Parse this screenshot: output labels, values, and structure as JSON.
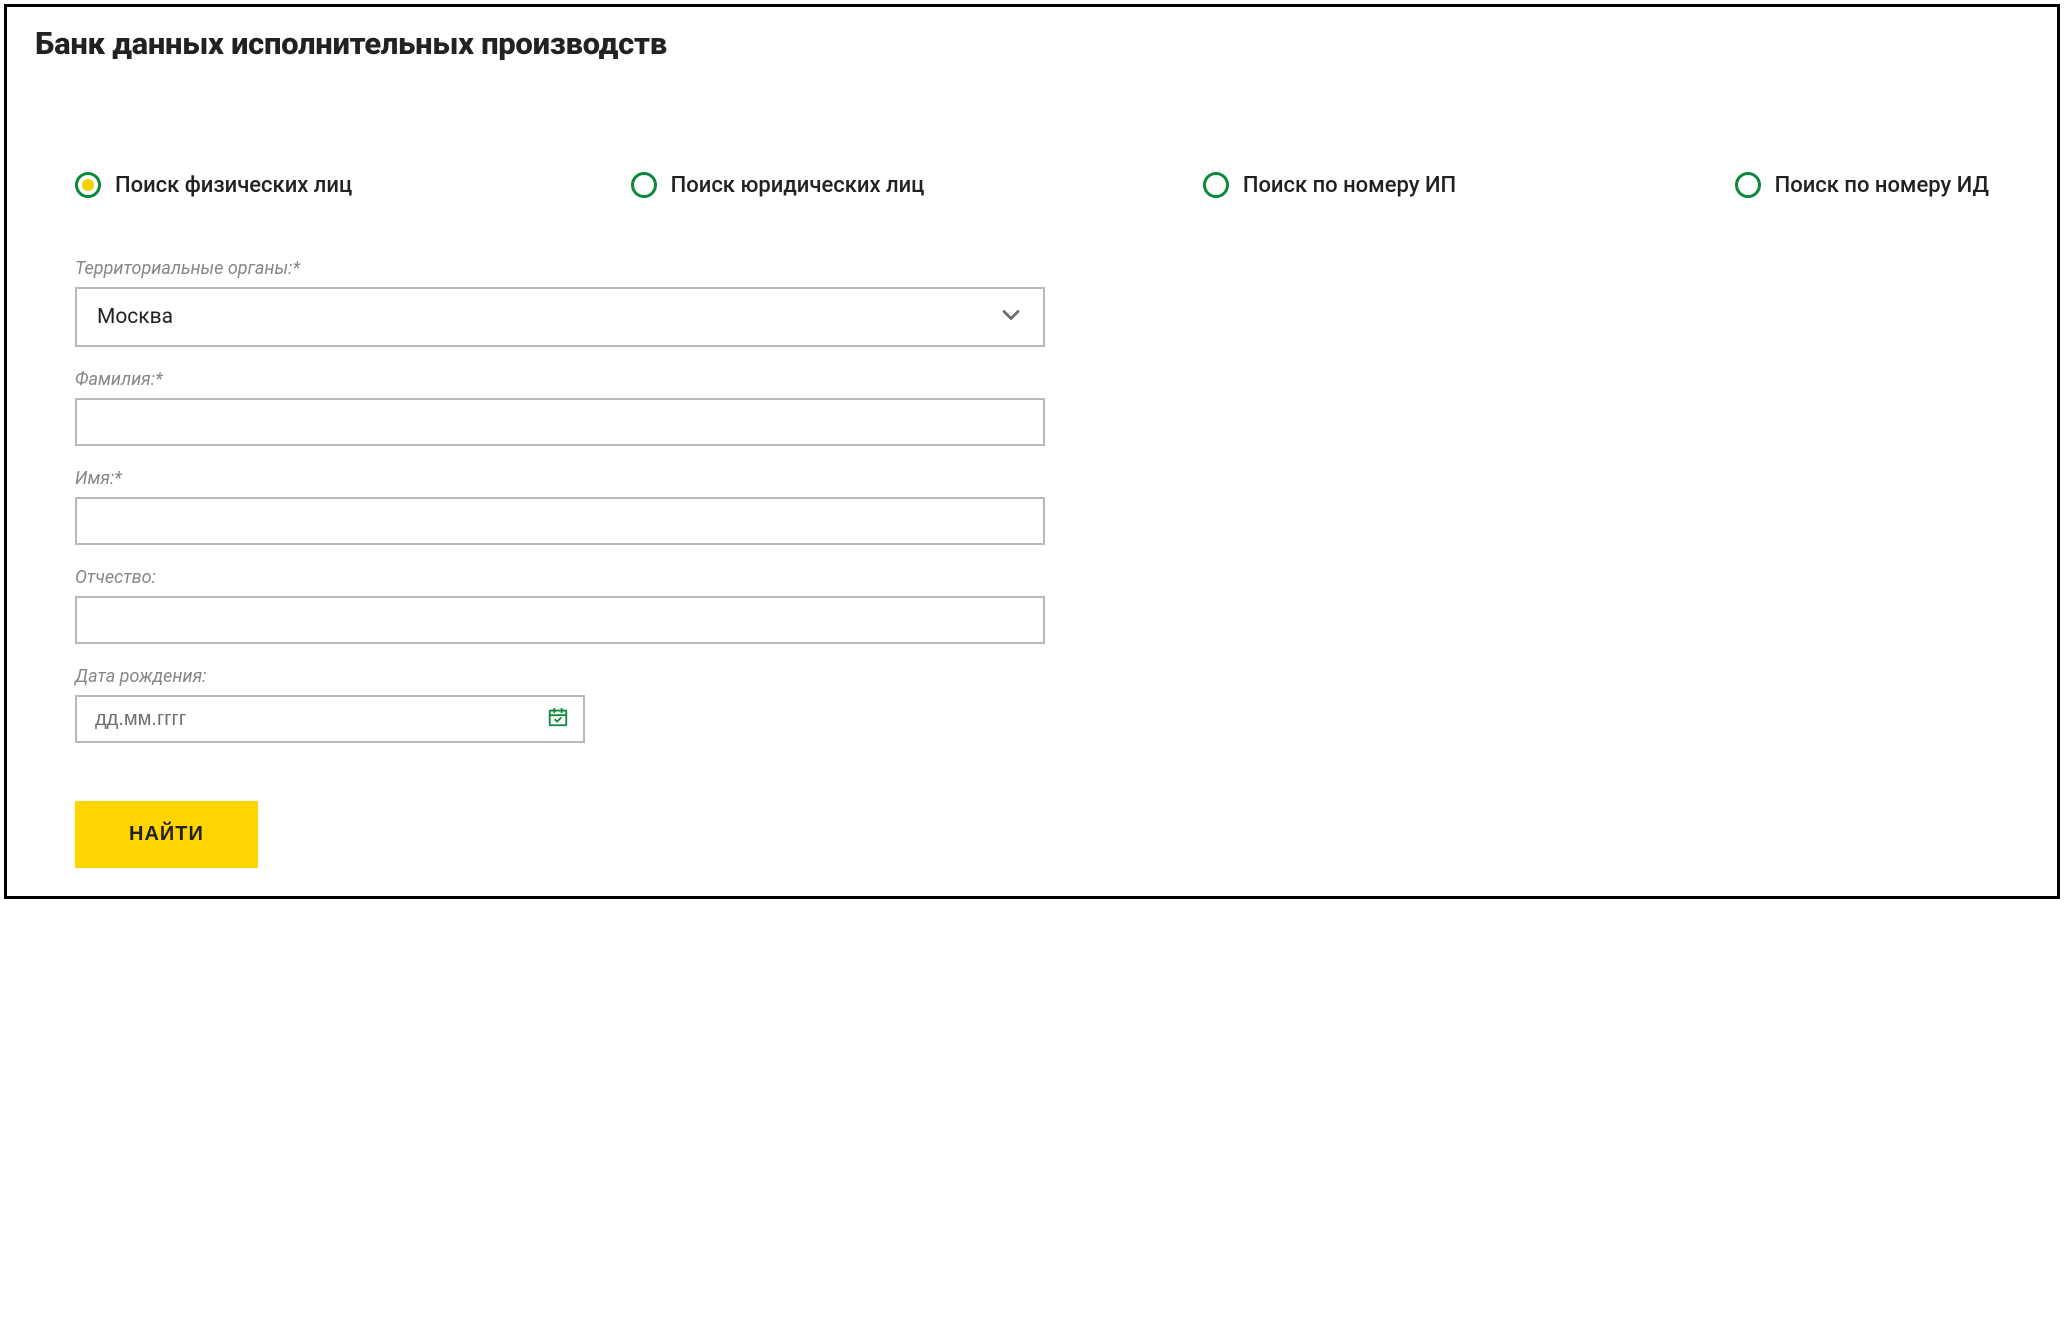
{
  "header": {
    "title": "Банк данных исполнительных производств"
  },
  "tabs": [
    {
      "label": "Поиск физических лиц",
      "selected": true
    },
    {
      "label": "Поиск юридических лиц",
      "selected": false
    },
    {
      "label": "Поиск по номеру ИП",
      "selected": false
    },
    {
      "label": "Поиск по номеру ИД",
      "selected": false
    }
  ],
  "form": {
    "region": {
      "label": "Территориальные органы:*",
      "value": "Москва"
    },
    "surname": {
      "label": "Фамилия:*",
      "value": ""
    },
    "name": {
      "label": "Имя:*",
      "value": ""
    },
    "patronymic": {
      "label": "Отчество:",
      "value": ""
    },
    "dob": {
      "label": "Дата рождения:",
      "placeholder": "дд.мм.гггг",
      "value": ""
    },
    "submit_label": "НАЙТИ"
  }
}
